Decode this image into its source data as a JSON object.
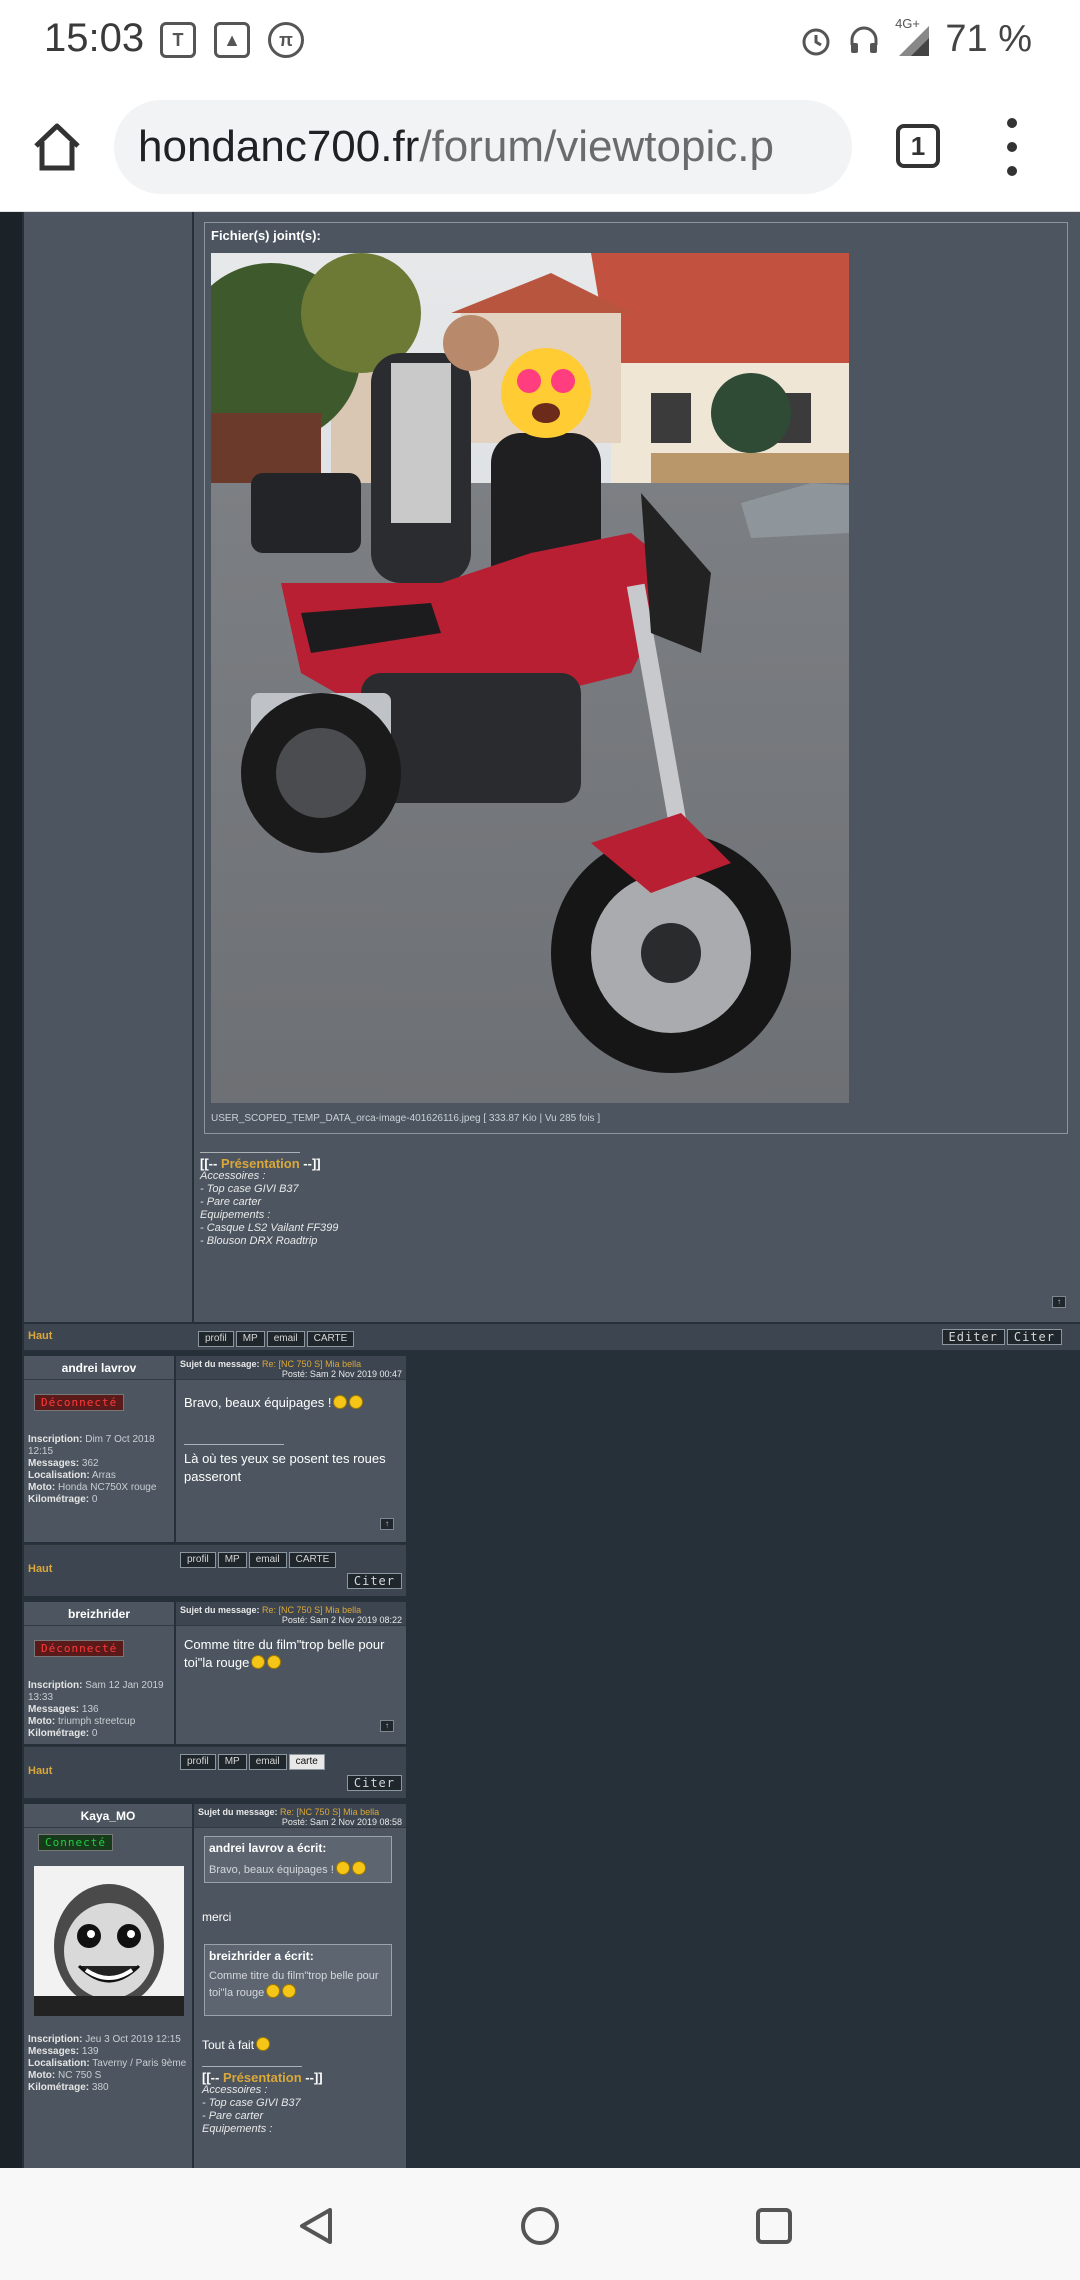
{
  "status_bar": {
    "time": "15:03",
    "battery": "71 %",
    "network": "4G+"
  },
  "browser": {
    "url_host": "hondanc700.fr",
    "url_path": "/forum/viewtopic.p",
    "tab_count": "1"
  },
  "post_main": {
    "attachments_title": "Fichier(s) joint(s):",
    "image_caption": "USER_SCOPED_TEMP_DATA_orca-image-401626116.jpeg [ 333.87 Kio | Vu 285 fois ]",
    "signature": {
      "prefix": "[[-- ",
      "title": "Présentation",
      "suffix": " --]]",
      "lines": [
        "Accessoires :",
        "- Top case GIVI B37",
        "- Pare carter",
        "Equipements :",
        "- Casque LS2 Vailant FF399",
        "- Blouson DRX Roadtrip"
      ]
    },
    "footer": {
      "haut": "Haut",
      "profil": "profil",
      "mp": "MP",
      "email": "email",
      "carte": "CARTE",
      "editer": "Editer",
      "citer": "Citer"
    }
  },
  "posts": [
    {
      "username": "andrei lavrov",
      "status": "Déconnecté",
      "inscription_label": "Inscription:",
      "inscription": "Dim 7 Oct 2018 12:15",
      "messages_label": "Messages:",
      "messages": "362",
      "localisation_label": "Localisation:",
      "localisation": "Arras",
      "moto_label": "Moto:",
      "moto": "Honda NC750X rouge",
      "km_label": "Kilométrage:",
      "km": "0",
      "subject_label": "Sujet du message:",
      "subject": "Re: [NC 750 S] Mia bella",
      "posted": "Posté: Sam 2 Nov 2019 00:47",
      "body_line1": "Bravo, beaux équipages !",
      "body_sig1": "Là où tes yeux se posent tes roues",
      "body_sig2": "passeront",
      "haut": "Haut",
      "profil": "profil",
      "mp": "MP",
      "email": "email",
      "carte": "CARTE",
      "citer": "Citer"
    },
    {
      "username": "breizhrider",
      "status": "Déconnecté",
      "inscription_label": "Inscription:",
      "inscription": "Sam 12 Jan 2019 13:33",
      "messages_label": "Messages:",
      "messages": "136",
      "moto_label": "Moto:",
      "moto": "triumph streetcup",
      "km_label": "Kilométrage:",
      "km": "0",
      "subject_label": "Sujet du message:",
      "subject": "Re: [NC 750 S] Mia bella",
      "posted": "Posté: Sam 2 Nov 2019 08:22",
      "body_line1": "Comme titre du film\"trop belle pour",
      "body_line2": "toi\"la rouge",
      "haut": "Haut",
      "profil": "profil",
      "mp": "MP",
      "email": "email",
      "carte": "carte",
      "citer": "Citer"
    },
    {
      "username": "Kaya_MO",
      "status": "Connecté",
      "inscription_label": "Inscription:",
      "inscription": "Jeu 3 Oct 2019 12:15",
      "messages_label": "Messages:",
      "messages": "139",
      "localisation_label": "Localisation:",
      "localisation": "Taverny / Paris 9ème",
      "moto_label": "Moto:",
      "moto": "NC 750 S",
      "km_label": "Kilométrage:",
      "km": "380",
      "subject_label": "Sujet du message:",
      "subject": "Re: [NC 750 S] Mia bella",
      "posted": "Posté: Sam 2 Nov 2019 08:58",
      "quote1_head": "andrei lavrov a écrit:",
      "quote1_body": "Bravo, beaux équipages !",
      "reply1": "merci",
      "quote2_head": "breizhrider a écrit:",
      "quote2_body1": "Comme titre du film\"trop belle pour",
      "quote2_body2": "toi\"la rouge",
      "reply2": "Tout à fait",
      "sig_prefix": "[[-- ",
      "sig_title": "Présentation",
      "sig_suffix": " --]]",
      "sig_lines": [
        "Accessoires :",
        "- Top case GIVI B37",
        "- Pare carter",
        "Equipements :"
      ]
    }
  ],
  "colors": {
    "forum_bg": "#263038",
    "panel": "#4d5660",
    "accent_gold": "#d9a73a",
    "offline_red": "#ff3a3a",
    "online_green": "#22cc44"
  }
}
